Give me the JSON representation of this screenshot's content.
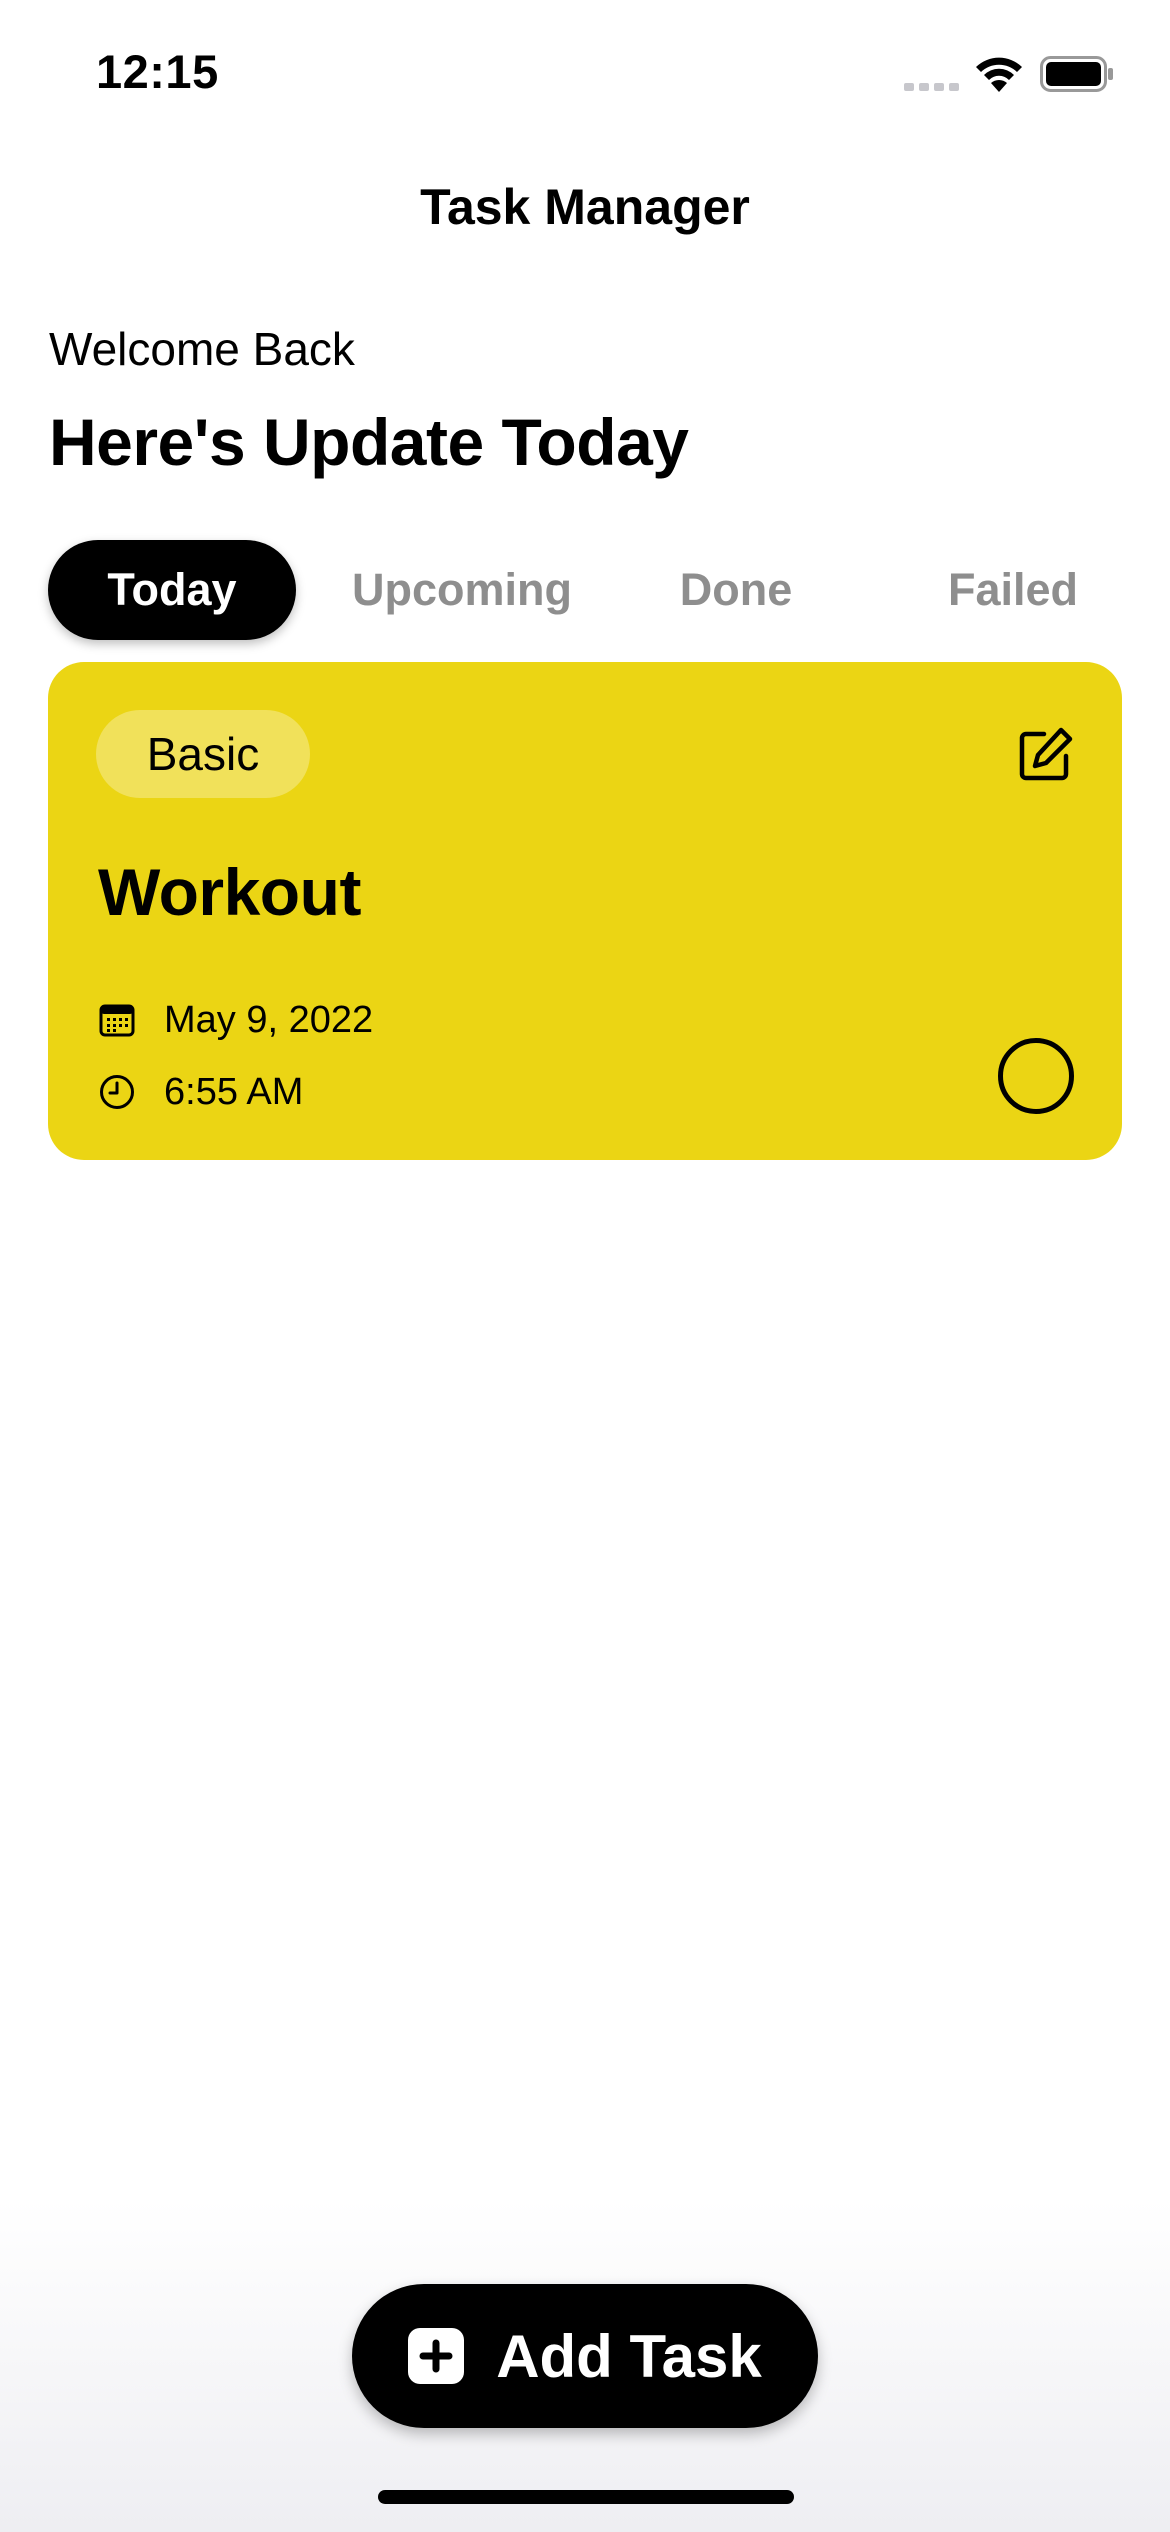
{
  "status_bar": {
    "time": "12:15",
    "icons": [
      "signal-icon",
      "wifi-icon",
      "battery-icon"
    ]
  },
  "nav": {
    "title": "Task Manager"
  },
  "greeting": {
    "welcome": "Welcome Back",
    "headline": "Here's Update Today"
  },
  "tabs": [
    {
      "label": "Today",
      "active": true
    },
    {
      "label": "Upcoming",
      "active": false
    },
    {
      "label": "Done",
      "active": false
    },
    {
      "label": "Failed",
      "active": false
    }
  ],
  "tasks": [
    {
      "category": "Basic",
      "title": "Workout",
      "date": "May 9, 2022",
      "time": "6:55 AM",
      "completed": false,
      "card_color": "#ebd514",
      "icons": [
        "edit-icon",
        "calendar-icon",
        "clock-icon"
      ]
    }
  ],
  "add_button": {
    "label": "Add Task",
    "icon": "plus-square-icon"
  },
  "colors": {
    "accent": "#000000",
    "card": "#ebd514",
    "tab_inactive": "#8e8e8e",
    "background": "#ffffff"
  }
}
